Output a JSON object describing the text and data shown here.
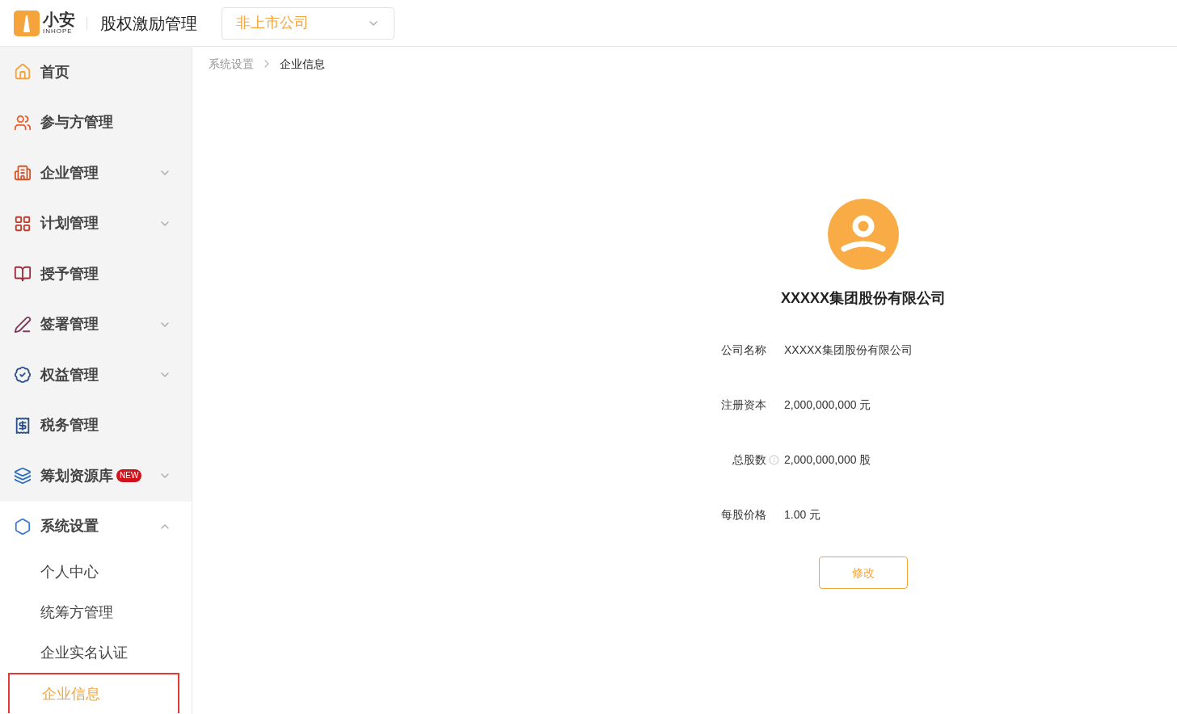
{
  "header": {
    "logo_text": "小安",
    "logo_sub": "INHOPE",
    "app_title": "股权激励管理",
    "company_select": {
      "value": "非上市公司"
    }
  },
  "sidebar": {
    "items": [
      {
        "label": "首页",
        "expandable": false
      },
      {
        "label": "参与方管理",
        "expandable": false
      },
      {
        "label": "企业管理",
        "expandable": true,
        "expanded": false
      },
      {
        "label": "计划管理",
        "expandable": true,
        "expanded": false
      },
      {
        "label": "授予管理",
        "expandable": false
      },
      {
        "label": "签署管理",
        "expandable": true,
        "expanded": false
      },
      {
        "label": "权益管理",
        "expandable": true,
        "expanded": false
      },
      {
        "label": "税务管理",
        "expandable": false
      },
      {
        "label": "筹划资源库",
        "badge": "NEW",
        "expandable": true,
        "expanded": false
      },
      {
        "label": "系统设置",
        "expandable": true,
        "expanded": true,
        "children": [
          {
            "label": "个人中心",
            "selected": false
          },
          {
            "label": "统筹方管理",
            "selected": false
          },
          {
            "label": "企业实名认证",
            "selected": false
          },
          {
            "label": "企业信息",
            "selected": true
          }
        ]
      }
    ]
  },
  "breadcrumb": [
    "系统设置",
    "企业信息"
  ],
  "company": {
    "name": "XXXXX集团股份有限公司",
    "fields": [
      {
        "label": "公司名称",
        "value": "XXXXX集团股份有限公司",
        "info": false
      },
      {
        "label": "注册资本",
        "value": "2,000,000,000 元",
        "info": false
      },
      {
        "label": "总股数",
        "value": "2,000,000,000 股",
        "info": true
      },
      {
        "label": "每股价格",
        "value": "1.00 元",
        "info": false
      }
    ],
    "edit_button": "修改"
  }
}
